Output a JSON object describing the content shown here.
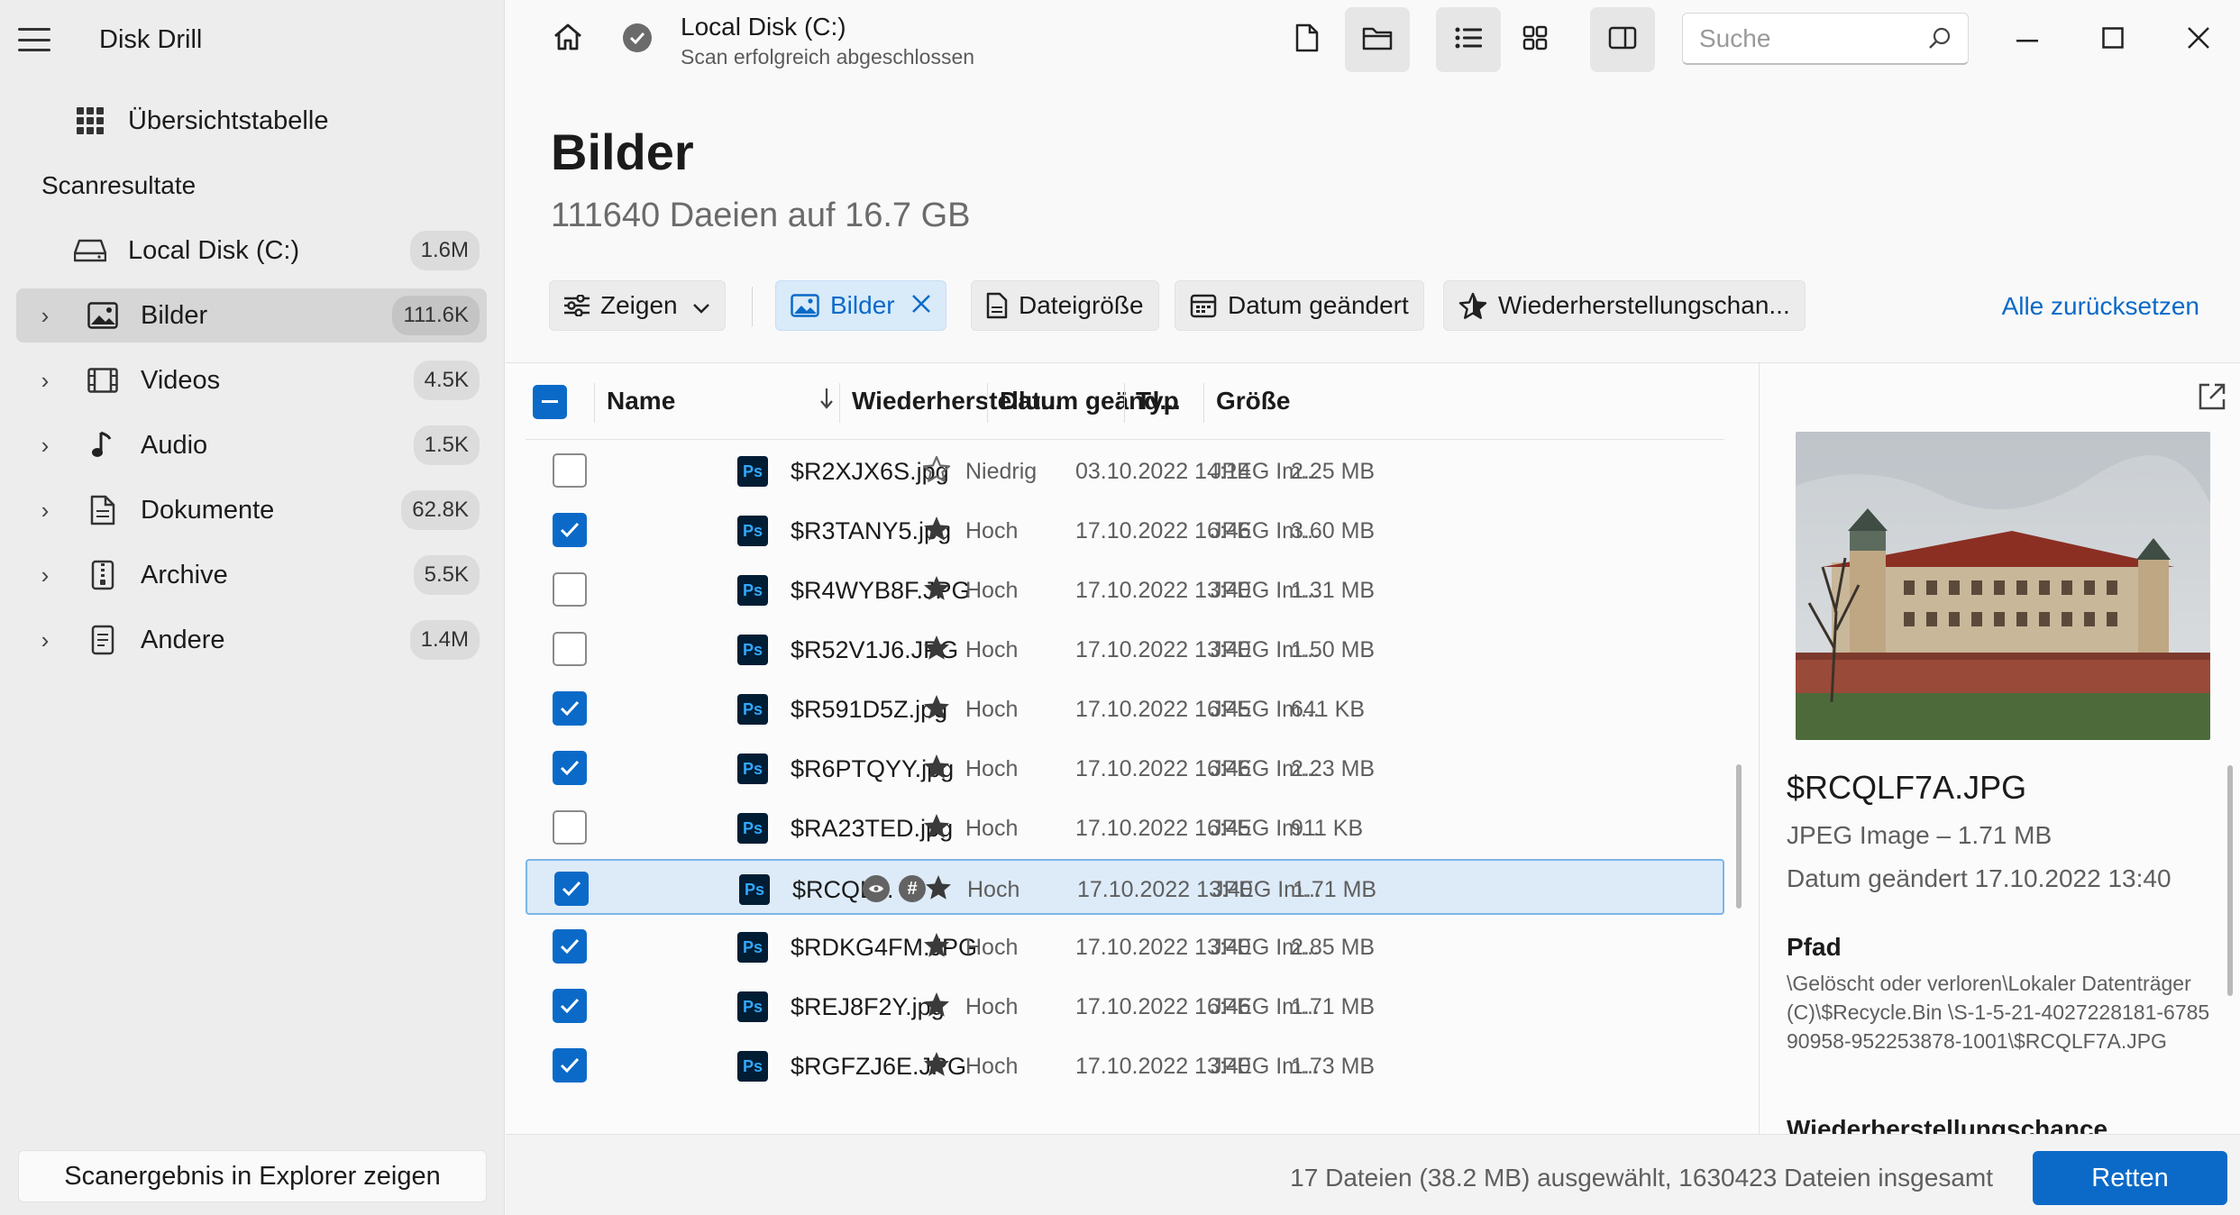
{
  "app": {
    "title": "Disk Drill"
  },
  "sidebar": {
    "overview_label": "Übersichtstabelle",
    "section_label": "Scanresultate",
    "disk": {
      "label": "Local Disk (C:)",
      "count": "1.6M"
    },
    "categories": [
      {
        "label": "Bilder",
        "count": "111.6K",
        "active": true
      },
      {
        "label": "Videos",
        "count": "4.5K"
      },
      {
        "label": "Audio",
        "count": "1.5K"
      },
      {
        "label": "Dokumente",
        "count": "62.8K"
      },
      {
        "label": "Archive",
        "count": "5.5K"
      },
      {
        "label": "Andere",
        "count": "1.4M"
      }
    ],
    "explorer_button": "Scanergebnis in Explorer zeigen"
  },
  "topbar": {
    "disk_title": "Local Disk (C:)",
    "disk_status": "Scan erfolgreich abgeschlossen",
    "search_placeholder": "Suche"
  },
  "page": {
    "title": "Bilder",
    "subtitle": "111640 Daeien auf 16.7 GB"
  },
  "filters": {
    "show_label": "Zeigen",
    "active_filter": "Bilder",
    "size_label": "Dateigröße",
    "date_label": "Datum geändert",
    "recovery_label": "Wiederherstellungschan...",
    "reset_label": "Alle zurücksetzen"
  },
  "table": {
    "headers": {
      "name": "Name",
      "recovery": "Wiederherstellu...",
      "date": "Datum geänd...",
      "type": "Typ",
      "size": "Größe"
    },
    "rows": [
      {
        "name": "$R2XJX6S.jpg",
        "recovery": "Niedrig",
        "date": "03.10.2022 14:14",
        "type": "JPEG Im...",
        "size": "2.25 MB",
        "checked": false,
        "star_filled": false
      },
      {
        "name": "$R3TANY5.jpg",
        "recovery": "Hoch",
        "date": "17.10.2022 16:46",
        "type": "JPEG Im...",
        "size": "3.60 MB",
        "checked": true,
        "star_filled": true
      },
      {
        "name": "$R4WYB8F.JPG",
        "recovery": "Hoch",
        "date": "17.10.2022 13:40",
        "type": "JPEG Im...",
        "size": "1.31 MB",
        "checked": false,
        "star_filled": true
      },
      {
        "name": "$R52V1J6.JPG",
        "recovery": "Hoch",
        "date": "17.10.2022 13:40",
        "type": "JPEG Im...",
        "size": "1.50 MB",
        "checked": false,
        "star_filled": true
      },
      {
        "name": "$R591D5Z.jpg",
        "recovery": "Hoch",
        "date": "17.10.2022 16:45",
        "type": "JPEG Im...",
        "size": "641 KB",
        "checked": true,
        "star_filled": true
      },
      {
        "name": "$R6PTQYY.jpg",
        "recovery": "Hoch",
        "date": "17.10.2022 16:46",
        "type": "JPEG Im...",
        "size": "2.23 MB",
        "checked": true,
        "star_filled": true
      },
      {
        "name": "$RA23TED.jpg",
        "recovery": "Hoch",
        "date": "17.10.2022 16:45",
        "type": "JPEG Im...",
        "size": "911 KB",
        "checked": false,
        "star_filled": true
      },
      {
        "name": "$RCQL...",
        "recovery": "Hoch",
        "date": "17.10.2022 13:40",
        "type": "JPEG Im...",
        "size": "1.71 MB",
        "checked": true,
        "star_filled": true,
        "selected": true
      },
      {
        "name": "$RDKG4FM.JPG",
        "recovery": "Hoch",
        "date": "17.10.2022 13:40",
        "type": "JPEG Im...",
        "size": "2.85 MB",
        "checked": true,
        "star_filled": true
      },
      {
        "name": "$REJ8F2Y.jpg",
        "recovery": "Hoch",
        "date": "17.10.2022 16:46",
        "type": "JPEG Im...",
        "size": "1.71 MB",
        "checked": true,
        "star_filled": true
      },
      {
        "name": "$RGFZJ6E.JPG",
        "recovery": "Hoch",
        "date": "17.10.2022 13:40",
        "type": "JPEG Im...",
        "size": "1.73 MB",
        "checked": true,
        "star_filled": true
      }
    ],
    "file_icon_label": "Ps"
  },
  "preview": {
    "name": "$RCQLF7A.JPG",
    "type_size": "JPEG Image – 1.71 MB",
    "date": "Datum geändert 17.10.2022 13:40",
    "path_heading": "Pfad",
    "path": "\\Gelöscht oder verloren\\Lokaler Datenträger (C)\\$Recycle.Bin \\S-1-5-21-4027228181-678590958-952253878-1001\\$RCQLF7A.JPG",
    "next_heading": "Wiederherstellungschance"
  },
  "footer": {
    "status": "17 Dateien (38.2 MB) ausgewählt, 1630423 Dateien insgesamt",
    "recover_button": "Retten"
  },
  "colors": {
    "accent": "#0b6ac8",
    "sidebar_bg": "#ededed",
    "selected_row": "#ddebf8"
  }
}
